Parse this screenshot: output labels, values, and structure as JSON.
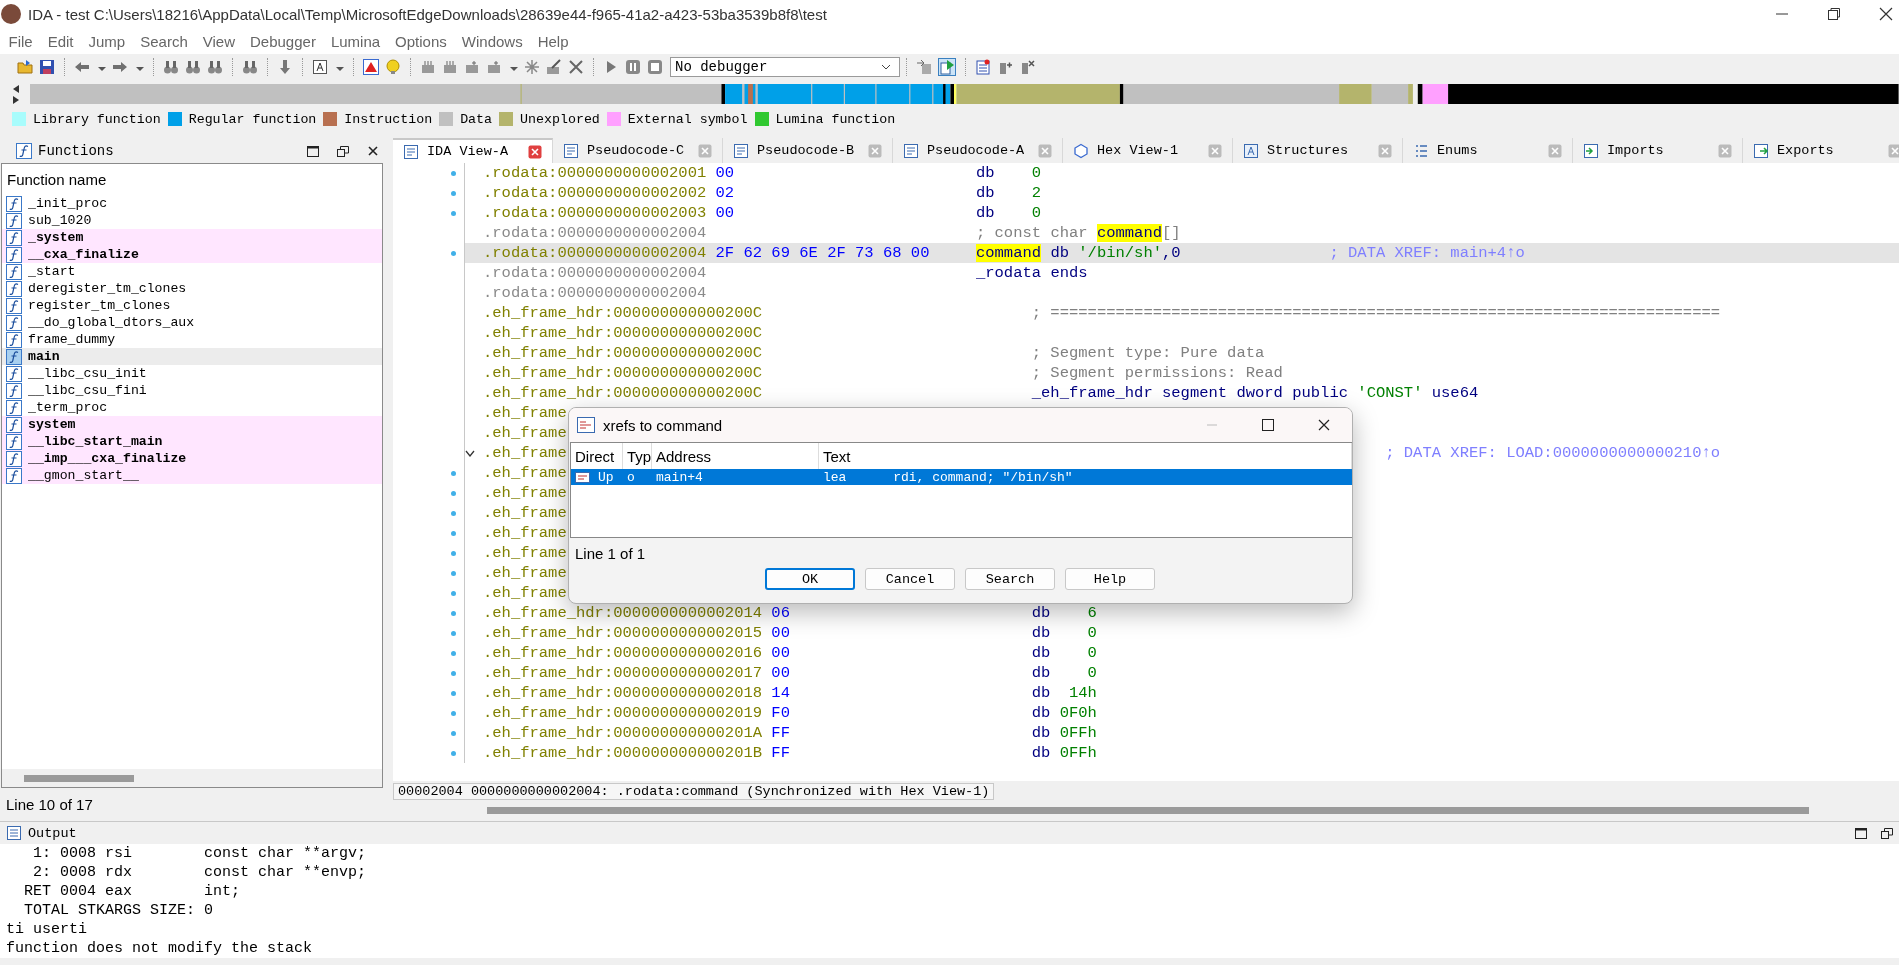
{
  "window": {
    "title": "IDA - test C:\\Users\\18216\\AppData\\Local\\Temp\\MicrosoftEdgeDownloads\\28639e44-f965-41a2-a423-53ba3539b8f8\\test"
  },
  "menu": [
    "File",
    "Edit",
    "Jump",
    "Search",
    "View",
    "Debugger",
    "Lumina",
    "Options",
    "Windows",
    "Help"
  ],
  "toolbar": {
    "debugger": "No debugger"
  },
  "legend": [
    {
      "label": "Library function",
      "color": "#a8fcfc"
    },
    {
      "label": "Regular function",
      "color": "#00a0e8"
    },
    {
      "label": "Instruction",
      "color": "#b87050"
    },
    {
      "label": "Data",
      "color": "#c0c0c0"
    },
    {
      "label": "Unexplored",
      "color": "#b4b46c"
    },
    {
      "label": "External symbol",
      "color": "#ffa0ff"
    },
    {
      "label": "Lumina function",
      "color": "#30c830"
    }
  ],
  "functions": {
    "title": "Functions",
    "column": "Function name",
    "status": "Line 10 of 17",
    "items": [
      {
        "name": "_init_proc",
        "kind": "regular",
        "bold": false,
        "selected": false
      },
      {
        "name": "sub_1020",
        "kind": "regular",
        "bold": false,
        "selected": false
      },
      {
        "name": "_system",
        "kind": "external",
        "bold": true,
        "selected": false
      },
      {
        "name": "__cxa_finalize",
        "kind": "external",
        "bold": true,
        "selected": false
      },
      {
        "name": "_start",
        "kind": "regular",
        "bold": false,
        "selected": false
      },
      {
        "name": "deregister_tm_clones",
        "kind": "regular",
        "bold": false,
        "selected": false
      },
      {
        "name": "register_tm_clones",
        "kind": "regular",
        "bold": false,
        "selected": false
      },
      {
        "name": "__do_global_dtors_aux",
        "kind": "regular",
        "bold": false,
        "selected": false
      },
      {
        "name": "frame_dummy",
        "kind": "regular",
        "bold": false,
        "selected": false
      },
      {
        "name": "main",
        "kind": "regular",
        "bold": true,
        "selected": true
      },
      {
        "name": "__libc_csu_init",
        "kind": "regular",
        "bold": false,
        "selected": false
      },
      {
        "name": "__libc_csu_fini",
        "kind": "regular",
        "bold": false,
        "selected": false
      },
      {
        "name": "_term_proc",
        "kind": "regular",
        "bold": false,
        "selected": false
      },
      {
        "name": "system",
        "kind": "external",
        "bold": true,
        "selected": false
      },
      {
        "name": "__libc_start_main",
        "kind": "external",
        "bold": true,
        "selected": false
      },
      {
        "name": "__imp___cxa_finalize",
        "kind": "external",
        "bold": true,
        "selected": false
      },
      {
        "name": "__gmon_start__",
        "kind": "external",
        "bold": false,
        "selected": false
      }
    ]
  },
  "tabs": [
    {
      "label": "IDA View-A",
      "kind": "disasm",
      "selected": true
    },
    {
      "label": "Pseudocode-C",
      "kind": "pseudo",
      "selected": false
    },
    {
      "label": "Pseudocode-B",
      "kind": "pseudo",
      "selected": false
    },
    {
      "label": "Pseudocode-A",
      "kind": "pseudo",
      "selected": false
    },
    {
      "label": "Hex View-1",
      "kind": "hex",
      "selected": false
    },
    {
      "label": "Structures",
      "kind": "struct",
      "selected": false
    },
    {
      "label": "Enums",
      "kind": "enum",
      "selected": false
    },
    {
      "label": "Imports",
      "kind": "import",
      "selected": false
    },
    {
      "label": "Exports",
      "kind": "export",
      "selected": false
    }
  ],
  "code": {
    "status": "00002004 0000000000002004: .rodata:command (Synchronized with Hex View-1)",
    "rows": [
      {
        "kind": "rodata",
        "address": ".rodata:0000000000002001",
        "bytes": "00",
        "ops": [
          {
            "text": "db",
            "kind": "keyword"
          },
          {
            "text": "    0",
            "kind": "number"
          }
        ],
        "marker": true,
        "foldable": false,
        "dim": false,
        "selected": false
      },
      {
        "kind": "rodata",
        "address": ".rodata:0000000000002002",
        "bytes": "02",
        "ops": [
          {
            "text": "db",
            "kind": "keyword"
          },
          {
            "text": "    2",
            "kind": "number"
          }
        ],
        "marker": true,
        "foldable": false,
        "dim": false,
        "selected": false
      },
      {
        "kind": "rodata",
        "address": ".rodata:0000000000002003",
        "bytes": "00",
        "ops": [
          {
            "text": "db",
            "kind": "keyword"
          },
          {
            "text": "    0",
            "kind": "number"
          }
        ],
        "marker": true,
        "foldable": false,
        "dim": false,
        "selected": false
      },
      {
        "kind": "rodata",
        "address": ".rodata:0000000000002004",
        "ops": [
          {
            "text": "; const char ",
            "kind": "comment"
          },
          {
            "text": "command",
            "kind": "highlight"
          },
          {
            "text": "[]",
            "kind": "comment"
          }
        ],
        "marker": false,
        "foldable": false,
        "dim": true,
        "selected": false
      },
      {
        "kind": "rodata",
        "address": ".rodata:0000000000002004",
        "bytes": "2F 62 69 6E 2F 73 68 00",
        "ops": [
          {
            "text": "command",
            "kind": "highlight"
          },
          {
            "text": " db ",
            "kind": "keyword"
          },
          {
            "text": "'/bin/sh'",
            "kind": "number"
          },
          {
            "text": ",0",
            "kind": "keyword"
          }
        ],
        "comment": "; DATA XREF: main+4↑o",
        "marker": true,
        "foldable": false,
        "dim": false,
        "selected": true
      },
      {
        "kind": "rodata",
        "address": ".rodata:0000000000002004",
        "ops": [
          {
            "text": "_rodata ends",
            "kind": "keyword"
          }
        ],
        "marker": false,
        "foldable": false,
        "dim": true,
        "selected": false
      },
      {
        "kind": "rodata",
        "address": ".rodata:0000000000002004",
        "marker": false,
        "foldable": false,
        "dim": true,
        "selected": false
      },
      {
        "kind": "eh_frame_hdr",
        "address": ".eh_frame_hdr:000000000000200C",
        "ops": [
          {
            "text": "; ========================================================================",
            "kind": "comment"
          }
        ],
        "marker": false,
        "foldable": false,
        "dim": false,
        "selected": false
      },
      {
        "kind": "eh_frame_hdr",
        "address": ".eh_frame_hdr:000000000000200C",
        "marker": false,
        "foldable": false,
        "dim": false,
        "selected": false
      },
      {
        "kind": "eh_frame_hdr",
        "address": ".eh_frame_hdr:000000000000200C",
        "ops": [
          {
            "text": "; Segment type: Pure data",
            "kind": "comment"
          }
        ],
        "marker": false,
        "foldable": false,
        "dim": false,
        "selected": false
      },
      {
        "kind": "eh_frame_hdr",
        "address": ".eh_frame_hdr:000000000000200C",
        "ops": [
          {
            "text": "; Segment permissions: Read",
            "kind": "comment"
          }
        ],
        "marker": false,
        "foldable": false,
        "dim": false,
        "selected": false
      },
      {
        "kind": "eh_frame_hdr",
        "address": ".eh_frame_hdr:000000000000200C",
        "ops": [
          {
            "text": "_eh_frame_hdr segment dword public ",
            "kind": "keyword"
          },
          {
            "text": "'CONST'",
            "kind": "number"
          },
          {
            "text": " use64",
            "kind": "keyword"
          }
        ],
        "marker": false,
        "foldable": false,
        "dim": false,
        "selected": false
      },
      {
        "kind": "eh_frame_hdr",
        "address": ".eh_frame",
        "marker": false,
        "foldable": false,
        "dim": false,
        "selected": false
      },
      {
        "kind": "eh_frame_hdr",
        "address": ".eh_frame",
        "marker": false,
        "foldable": false,
        "dim": false,
        "selected": false
      },
      {
        "kind": "eh_frame_hdr",
        "address": ".eh_frame",
        "comment": "; DATA XREF: LOAD:0000000000000210↑o",
        "marker": false,
        "foldable": true,
        "dim": false,
        "selected": false
      },
      {
        "kind": "eh_frame_hdr",
        "address": ".eh_frame",
        "marker": true,
        "foldable": false,
        "dim": false,
        "selected": false
      },
      {
        "kind": "eh_frame_hdr",
        "address": ".eh_frame",
        "marker": true,
        "foldable": false,
        "dim": false,
        "selected": false
      },
      {
        "kind": "eh_frame_hdr",
        "address": ".eh_frame",
        "marker": true,
        "foldable": false,
        "dim": false,
        "selected": false
      },
      {
        "kind": "eh_frame_hdr",
        "address": ".eh_frame",
        "marker": true,
        "foldable": false,
        "dim": false,
        "selected": false
      },
      {
        "kind": "eh_frame_hdr",
        "address": ".eh_frame",
        "marker": true,
        "foldable": false,
        "dim": false,
        "selected": false
      },
      {
        "kind": "eh_frame_hdr",
        "address": ".eh_frame",
        "marker": true,
        "foldable": false,
        "dim": false,
        "selected": false
      },
      {
        "kind": "eh_frame_hdr",
        "address": ".eh_frame",
        "marker": true,
        "foldable": false,
        "dim": false,
        "selected": false
      },
      {
        "kind": "eh_frame_hdr",
        "address": ".eh_frame_hdr:0000000000002014",
        "bytes": "06",
        "ops": [
          {
            "text": "db",
            "kind": "keyword"
          },
          {
            "text": "    6",
            "kind": "number"
          }
        ],
        "marker": true,
        "foldable": false,
        "dim": false,
        "selected": false
      },
      {
        "kind": "eh_frame_hdr",
        "address": ".eh_frame_hdr:0000000000002015",
        "bytes": "00",
        "ops": [
          {
            "text": "db",
            "kind": "keyword"
          },
          {
            "text": "    0",
            "kind": "number"
          }
        ],
        "marker": true,
        "foldable": false,
        "dim": false,
        "selected": false
      },
      {
        "kind": "eh_frame_hdr",
        "address": ".eh_frame_hdr:0000000000002016",
        "bytes": "00",
        "ops": [
          {
            "text": "db",
            "kind": "keyword"
          },
          {
            "text": "    0",
            "kind": "number"
          }
        ],
        "marker": true,
        "foldable": false,
        "dim": false,
        "selected": false
      },
      {
        "kind": "eh_frame_hdr",
        "address": ".eh_frame_hdr:0000000000002017",
        "bytes": "00",
        "ops": [
          {
            "text": "db",
            "kind": "keyword"
          },
          {
            "text": "    0",
            "kind": "number"
          }
        ],
        "marker": true,
        "foldable": false,
        "dim": false,
        "selected": false
      },
      {
        "kind": "eh_frame_hdr",
        "address": ".eh_frame_hdr:0000000000002018",
        "bytes": "14",
        "ops": [
          {
            "text": "db",
            "kind": "keyword"
          },
          {
            "text": "  14h",
            "kind": "number"
          }
        ],
        "marker": true,
        "foldable": false,
        "dim": false,
        "selected": false
      },
      {
        "kind": "eh_frame_hdr",
        "address": ".eh_frame_hdr:0000000000002019",
        "bytes": "F0",
        "ops": [
          {
            "text": "db",
            "kind": "keyword"
          },
          {
            "text": " 0F0h",
            "kind": "number"
          }
        ],
        "marker": true,
        "foldable": false,
        "dim": false,
        "selected": false
      },
      {
        "kind": "eh_frame_hdr",
        "address": ".eh_frame_hdr:000000000000201A",
        "bytes": "FF",
        "ops": [
          {
            "text": "db",
            "kind": "keyword"
          },
          {
            "text": " 0FFh",
            "kind": "number"
          }
        ],
        "marker": true,
        "foldable": false,
        "dim": false,
        "selected": false
      },
      {
        "kind": "eh_frame_hdr",
        "address": ".eh_frame_hdr:000000000000201B",
        "bytes": "FF",
        "ops": [
          {
            "text": "db",
            "kind": "keyword"
          },
          {
            "text": " 0FFh",
            "kind": "number"
          }
        ],
        "marker": true,
        "foldable": false,
        "dim": false,
        "selected": false
      }
    ]
  },
  "xrefs": {
    "title": "xrefs to command",
    "columns": [
      "Direct",
      "Typ",
      "Address",
      "Text"
    ],
    "status": "Line 1 of 1",
    "rows": [
      {
        "direct": "Up",
        "type": "o",
        "address": "main+4",
        "text": "lea      rdi, command; \"/bin/sh\"",
        "selected": true
      }
    ],
    "buttons": [
      {
        "label": "OK",
        "focused": true
      },
      {
        "label": "Cancel",
        "focused": false
      },
      {
        "label": "Search",
        "focused": false
      },
      {
        "label": "Help",
        "focused": false
      }
    ]
  },
  "output": {
    "title": "Output",
    "lines": [
      "   1: 0008 rsi        const char **argv;",
      "   2: 0008 rdx        const char **envp;",
      "  RET 0004 eax        int;",
      "  TOTAL STKARGS SIZE: 0",
      "ti userti",
      "function does not modify the stack"
    ]
  }
}
